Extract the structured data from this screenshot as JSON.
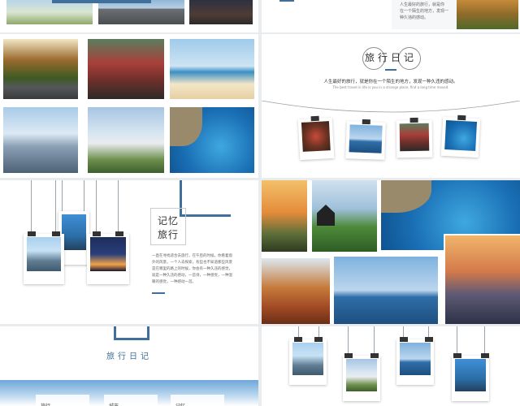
{
  "slide2": {
    "caption_lines": [
      "人生最好的旅行，就是你",
      "在一个陌生的地方，发现一",
      "种久违的感动。"
    ]
  },
  "slide4": {
    "title": "旅行日记",
    "quote_cn": "人生最好的旅行，就是你在一个陌生的地方，发现一种久违的感动。",
    "quote_en": "The best travel in life is you in a strange place, find a long time moved."
  },
  "slide5": {
    "title_line1": "记忆",
    "title_line2": "旅行",
    "body": "一直在寻找适合去旅行，在午后的时候，你看着窗外的风景，一个人去探索，有些也不知道那些风景是在哪里的路上的时候，你会有一种久违的感觉，就是一种久违的感动，一首诗，一种感觉，一种温暖的感觉，一种感动一首。"
  },
  "slide7": {
    "title": "旅行日记",
    "tabs": [
      "旅行",
      "城市",
      "记忆"
    ]
  },
  "colors": {
    "accent": "#3f6f9a",
    "background": "#e9ecef"
  }
}
